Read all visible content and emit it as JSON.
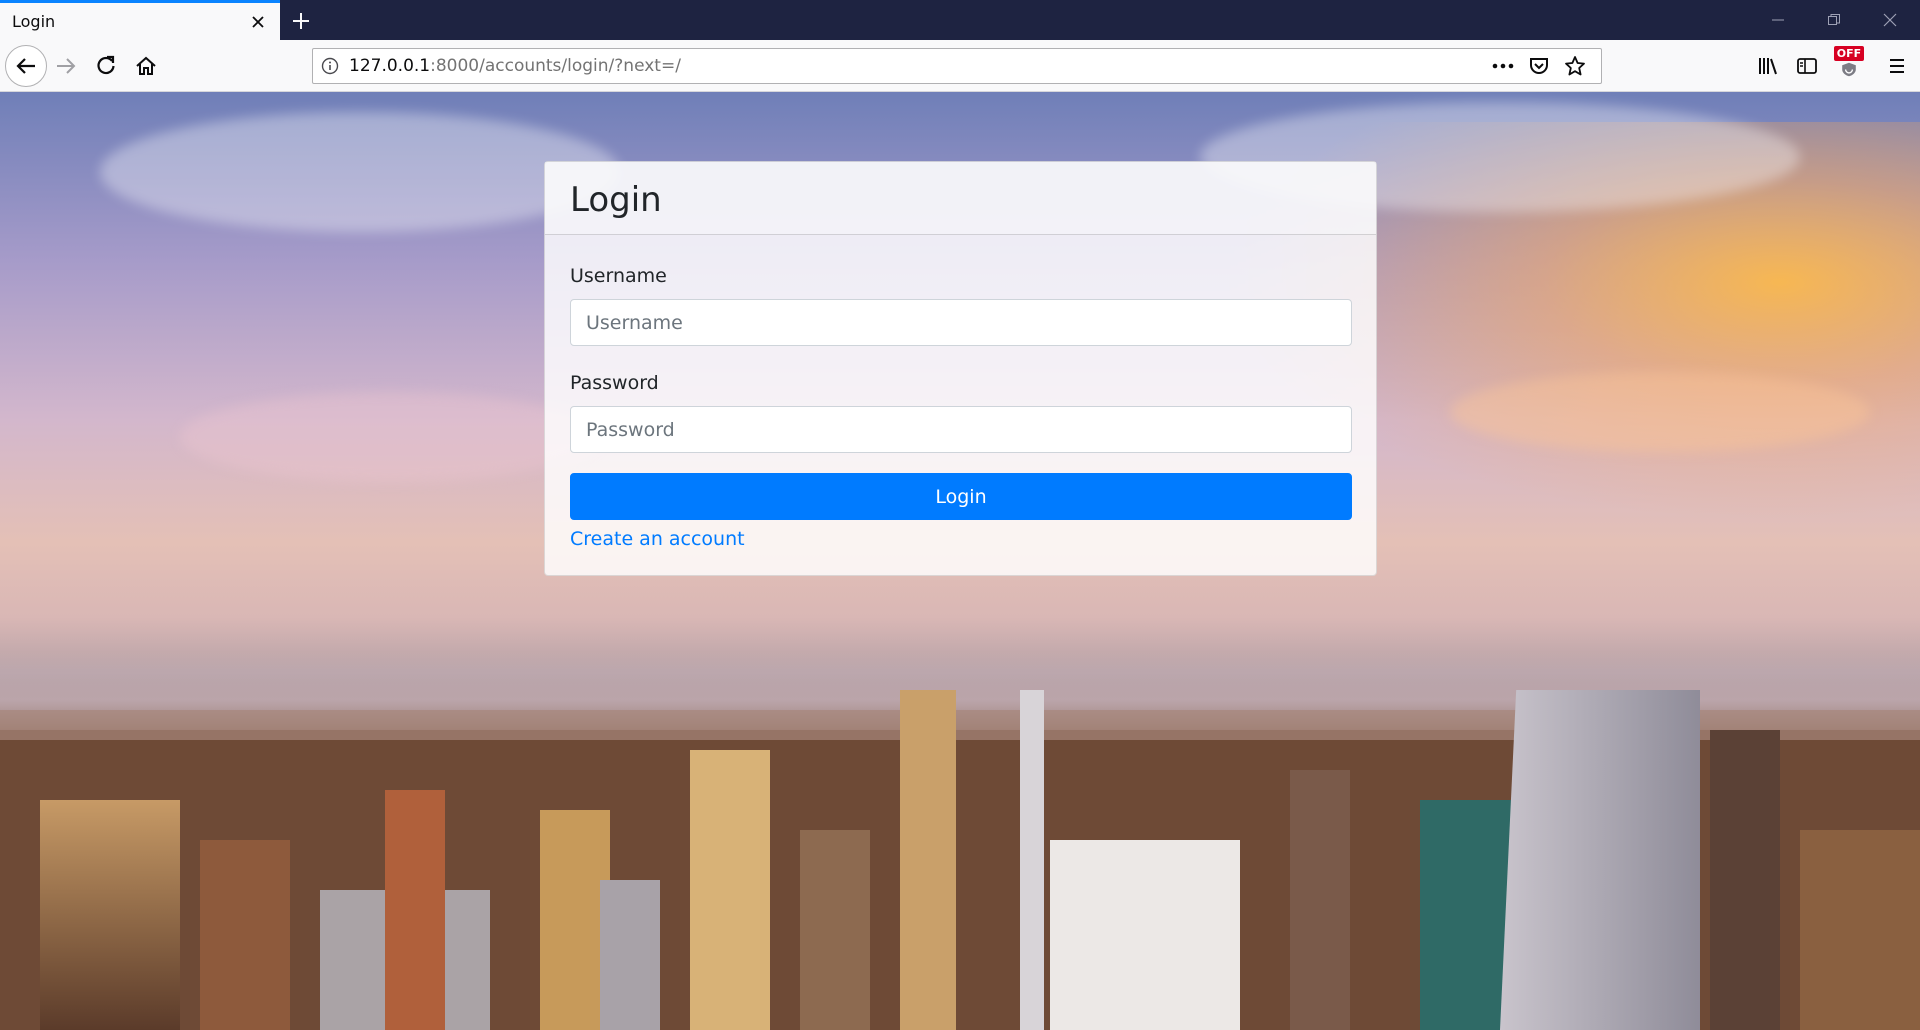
{
  "browser": {
    "tab": {
      "title": "Login"
    },
    "url": {
      "host": "127.0.0.1",
      "rest": ":8000/accounts/login/?next=/"
    },
    "addon_badge": "OFF"
  },
  "login_card": {
    "title": "Login",
    "username_label": "Username",
    "username_placeholder": "Username",
    "username_value": "",
    "password_label": "Password",
    "password_placeholder": "Password",
    "password_value": "",
    "submit_label": "Login",
    "create_account_link": "Create an account"
  },
  "colors": {
    "primary": "#007bff",
    "tab_accent": "#0a84ff",
    "tabstrip_bg": "#1e2341"
  },
  "icons": [
    "close-icon",
    "plus-icon",
    "minimize-icon",
    "restore-icon",
    "back-arrow-icon",
    "forward-arrow-icon",
    "reload-icon",
    "home-icon",
    "info-icon",
    "more-dots-icon",
    "pocket-icon",
    "bookmark-star-icon",
    "library-icon",
    "sidebar-icon",
    "addon-icon",
    "hamburger-menu-icon"
  ]
}
